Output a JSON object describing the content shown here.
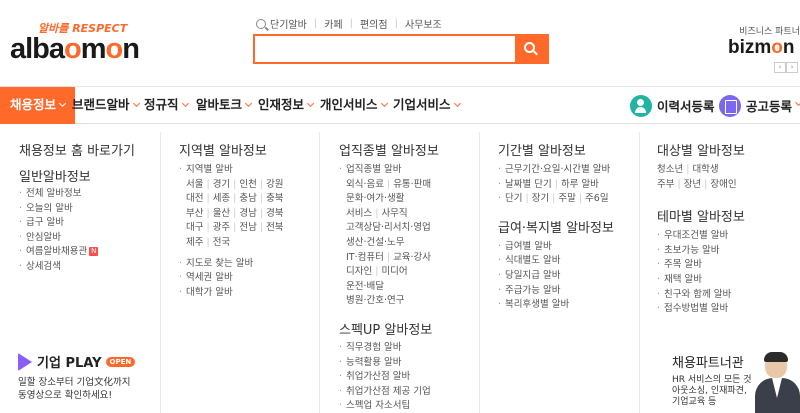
{
  "header": {
    "slogan": "알바를 RESPECT",
    "logo_pre": "alba",
    "logo_o": "o",
    "logo_m": "m",
    "logo_post": "n",
    "keywords": [
      "단기알바",
      "카페",
      "편의점",
      "사무보조"
    ],
    "search": {
      "value": "",
      "placeholder": ""
    },
    "bizmon_sub": "비즈니스 파트너",
    "bizmon_pre": "bizm",
    "bizmon_o": "o",
    "bizmon_post": "n",
    "nav_prev": "‹",
    "nav_next": "›"
  },
  "gnb": {
    "items": [
      "채용정보",
      "브랜드알바",
      "정규직",
      "알바토크",
      "인재정보",
      "개인서비스",
      "기업서비스"
    ],
    "resume": "이력서등록",
    "notice": "공고등록"
  },
  "menu": {
    "home": {
      "title": "채용정보 홈 바로가기",
      "sub_title": "일반알바정보",
      "links": [
        "전체 알바정보",
        "오늘의 알바",
        "급구 알바",
        "안심알바",
        "여름알바채용관",
        "상세검색"
      ],
      "hot_mark": "N"
    },
    "region": {
      "title": "지역별 알바정보",
      "head_link": "지역별 알바",
      "rows": [
        [
          "서울",
          "경기",
          "인천",
          "강원"
        ],
        [
          "대전",
          "세종",
          "충남",
          "충북"
        ],
        [
          "부산",
          "울산",
          "경남",
          "경북"
        ],
        [
          "대구",
          "광주",
          "전남",
          "전북"
        ],
        [
          "제주",
          "전국"
        ]
      ],
      "links": [
        "지도로 찾는 알바",
        "역세권 알바",
        "대학가 알바"
      ]
    },
    "job": {
      "title": "업직종별 알바정보",
      "head_link": "업직종별 알바",
      "rows": [
        [
          "외식·음료",
          "유통·판매"
        ],
        [
          "문화·여가·생활"
        ],
        [
          "서비스",
          "사무직"
        ],
        [
          "고객상담·리서치·영업"
        ],
        [
          "생산·건설·노무"
        ],
        [
          "IT·컴퓨터",
          "교육·강사"
        ],
        [
          "디자인",
          "미디어"
        ],
        [
          "운전·배달"
        ],
        [
          "병원·간호·연구"
        ]
      ],
      "spec_title": "스펙UP 알바정보",
      "spec_links": [
        "직무경험 알바",
        "능력활용 알바",
        "취업가산점 알바",
        "취업가산점 제공 기업",
        "스펙업 자소서팁"
      ]
    },
    "period": {
      "title": "기간별 알바정보",
      "links": [
        "근무기간·요일·시간별 알바"
      ],
      "rows": [
        [
          "날짜별 단기",
          "하루 알바"
        ],
        [
          "단기",
          "장기",
          "주말",
          "주6일"
        ]
      ],
      "welfare_title": "급여·복지별 알바정보",
      "welfare_links": [
        "급여별 알바",
        "식대별도 알바",
        "당일지급 알바",
        "주급가능 알바",
        "복리후생별 알바"
      ]
    },
    "target": {
      "title": "대상별 알바정보",
      "rows": [
        [
          "청소년",
          "대학생"
        ],
        [
          "주부",
          "장년",
          "장애인"
        ]
      ],
      "theme_title": "테마별 알바정보",
      "theme_links": [
        "우대조건별 알바",
        "초보가능 알바",
        "주목 알바",
        "재택 알바",
        "친구와 함께 알바",
        "접수방법별 알바"
      ]
    }
  },
  "promo": {
    "play_name": "기업 PLAY",
    "play_badge": "OPEN",
    "play_line1": "일할 장소부터 기업文化까지",
    "play_line2": "동영상으로 확인하세요!",
    "partner_title": "채용파트너관",
    "partner_line1": "HR 서비스의 모든 것",
    "partner_line2": "아웃소싱, 인재파견,",
    "partner_line3": "기업교육 등"
  },
  "colors": {
    "brand": "#ff6a2b",
    "highlight": "#fff99c",
    "resume": "#21b3a3",
    "notice": "#7b68ee"
  }
}
